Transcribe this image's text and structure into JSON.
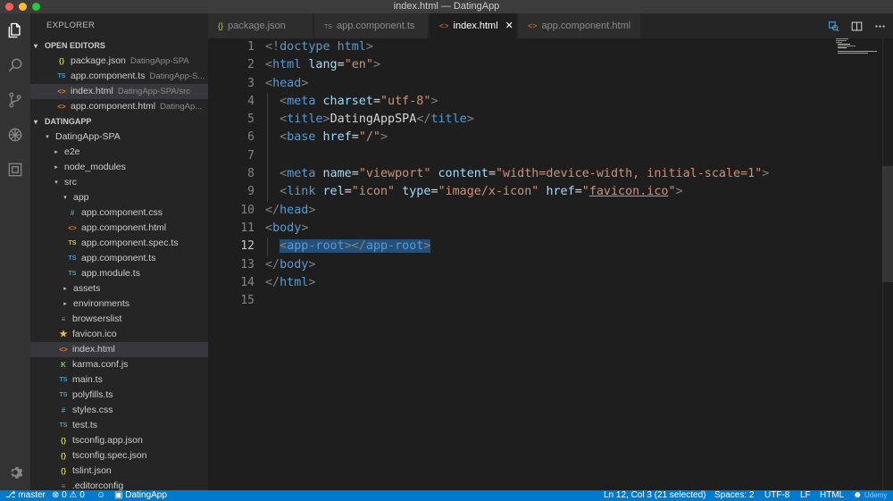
{
  "window": {
    "title": "index.html — DatingApp"
  },
  "sidebar": {
    "header": "EXPLORER",
    "open_editors_title": "OPEN EDITORS",
    "open_editors": [
      {
        "icon": "{}",
        "type": "json",
        "name": "package.json",
        "desc": "DatingApp-SPA"
      },
      {
        "icon": "TS",
        "type": "ts",
        "name": "app.component.ts",
        "desc": "DatingApp-S..."
      },
      {
        "icon": "<>",
        "type": "html",
        "name": "index.html",
        "desc": "DatingApp-SPA/src"
      },
      {
        "icon": "<>",
        "type": "html",
        "name": "app.component.html",
        "desc": "DatingAp..."
      }
    ],
    "project_title": "DATINGAPP",
    "tree": [
      {
        "chev": "▾",
        "icon": "",
        "name": "DatingApp-SPA"
      },
      {
        "chev": "▸",
        "icon": "",
        "name": "e2e"
      },
      {
        "chev": "▸",
        "icon": "",
        "name": "node_modules"
      },
      {
        "chev": "▾",
        "icon": "",
        "name": "src"
      },
      {
        "chev": "▾",
        "icon": "",
        "name": "app"
      },
      {
        "chev": "",
        "icon": "#",
        "name": "app.component.css"
      },
      {
        "chev": "",
        "icon": "<>",
        "name": "app.component.html"
      },
      {
        "chev": "",
        "icon": "TS",
        "name": "app.component.spec.ts"
      },
      {
        "chev": "",
        "icon": "TS",
        "name": "app.component.ts"
      },
      {
        "chev": "",
        "icon": "TS",
        "name": "app.module.ts"
      },
      {
        "chev": "▸",
        "icon": "",
        "name": "assets"
      },
      {
        "chev": "▸",
        "icon": "",
        "name": "environments"
      },
      {
        "chev": "",
        "icon": "≡",
        "name": "browserslist"
      },
      {
        "chev": "",
        "icon": "★",
        "name": "favicon.ico"
      },
      {
        "chev": "",
        "icon": "<>",
        "name": "index.html"
      },
      {
        "chev": "",
        "icon": "K",
        "name": "karma.conf.js"
      },
      {
        "chev": "",
        "icon": "TS",
        "name": "main.ts"
      },
      {
        "chev": "",
        "icon": "TS",
        "name": "polyfills.ts"
      },
      {
        "chev": "",
        "icon": "#",
        "name": "styles.css"
      },
      {
        "chev": "",
        "icon": "TS",
        "name": "test.ts"
      },
      {
        "chev": "",
        "icon": "{}",
        "name": "tsconfig.app.json"
      },
      {
        "chev": "",
        "icon": "{}",
        "name": "tsconfig.spec.json"
      },
      {
        "chev": "",
        "icon": "{}",
        "name": "tslint.json"
      },
      {
        "chev": "",
        "icon": "≡",
        "name": ".editorconfig"
      }
    ]
  },
  "tabs": [
    {
      "icon": "{}",
      "label": "package.json"
    },
    {
      "icon": "TS",
      "label": "app.component.ts"
    },
    {
      "icon": "<>",
      "label": "index.html",
      "close": "✕"
    },
    {
      "icon": "<>",
      "label": "app.component.html"
    }
  ],
  "editor": {
    "line_numbers": [
      "1",
      "2",
      "3",
      "4",
      "5",
      "6",
      "7",
      "8",
      "9",
      "10",
      "11",
      "12",
      "13",
      "14",
      "15"
    ],
    "current_line": 12,
    "code": {
      "l1_p1": "<!",
      "l1_t": "doctype",
      "l1_x": " html",
      "l1_p2": ">",
      "l2_p1": "<",
      "l2_t": "html",
      "l2_a": "lang",
      "l2_eq": "=",
      "l2_s": "\"en\"",
      "l2_p2": ">",
      "l3_p1": "<",
      "l3_t": "head",
      "l3_p2": ">",
      "l4_p1": "<",
      "l4_t": "meta",
      "l4_a": "charset",
      "l4_eq": "=",
      "l4_s": "\"utf-8\"",
      "l4_p2": ">",
      "l5_p1": "<",
      "l5_t": "title",
      "l5_p2": ">",
      "l5_x": "DatingAppSPA",
      "l5_p3": "</",
      "l5_t2": "title",
      "l5_p4": ">",
      "l6_p1": "<",
      "l6_t": "base",
      "l6_a": "href",
      "l6_eq": "=",
      "l6_s": "\"/\"",
      "l6_p2": ">",
      "l8_p1": "<",
      "l8_t": "meta",
      "l8_a1": "name",
      "l8_eq1": "=",
      "l8_s1": "\"viewport\"",
      "l8_a2": "content",
      "l8_eq2": "=",
      "l8_s2": "\"width=device-width, initial-scale=1\"",
      "l8_p2": ">",
      "l9_p1": "<",
      "l9_t": "link",
      "l9_a1": "rel",
      "l9_eq1": "=",
      "l9_s1": "\"icon\"",
      "l9_a2": "type",
      "l9_eq2": "=",
      "l9_s2": "\"image/x-icon\"",
      "l9_a3": "href",
      "l9_eq3": "=",
      "l9_q1": "\"",
      "l9_s3": "favicon.ico",
      "l9_q2": "\"",
      "l9_p2": ">",
      "l10_p1": "</",
      "l10_t": "head",
      "l10_p2": ">",
      "l11_p1": "<",
      "l11_t": "body",
      "l11_p2": ">",
      "l12_p1": "<",
      "l12_t": "app-root",
      "l12_p2": "></",
      "l12_t2": "app-root",
      "l12_p3": ">",
      "l13_p1": "</",
      "l13_t": "body",
      "l13_p2": ">",
      "l14_p1": "</",
      "l14_t": "html",
      "l14_p2": ">"
    }
  },
  "status": {
    "branch": "master",
    "errors": "0",
    "warnings": "0",
    "folder": "DatingApp",
    "position": "Ln 12, Col 3 (21 selected)",
    "spaces": "Spaces: 2",
    "encoding": "UTF-8",
    "eol": "LF",
    "language": "HTML",
    "watermark": "Udemy"
  },
  "colors": {
    "accent": "#007acc",
    "tag": "#569cd6",
    "attribute": "#9cdcfe",
    "string": "#ce9178",
    "selection": "#264f78"
  }
}
